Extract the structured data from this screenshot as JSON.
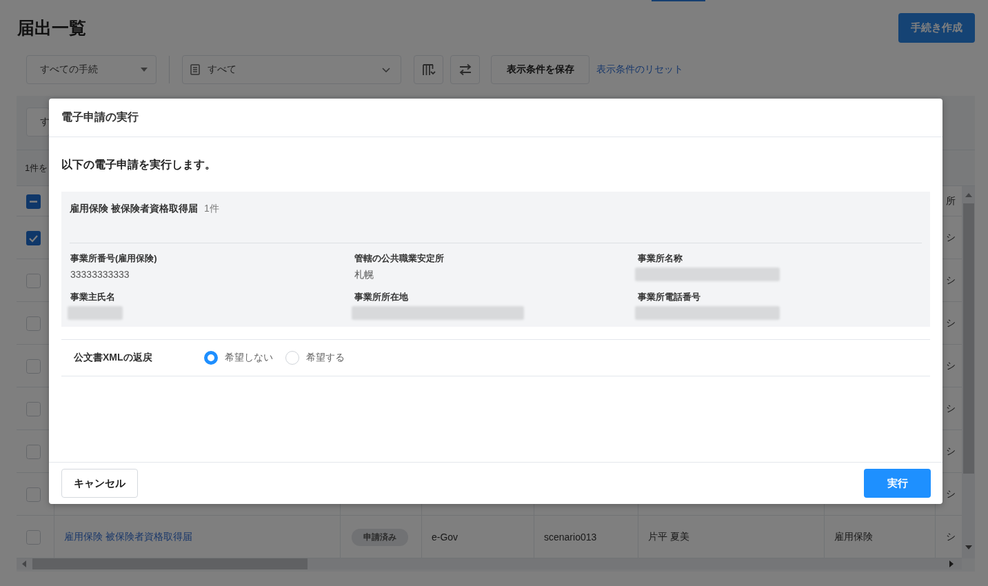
{
  "page": {
    "title": "届出一覧",
    "create_button": "手続き作成"
  },
  "toolbar": {
    "procedure_filter": "すべての手続",
    "document_filter": "すべて",
    "save_button": "表示条件を保存",
    "reset_link": "表示条件のリセット"
  },
  "list": {
    "filter_button": "す",
    "selection_summary": "1件を",
    "table": {
      "header": {
        "select_all_mixed": true,
        "column_8": "所"
      },
      "rows": [
        {
          "checked": true,
          "column_8": "シ"
        },
        {
          "checked": false,
          "column_8": "シ"
        },
        {
          "checked": false,
          "column_8": "シ"
        },
        {
          "checked": false,
          "column_8": "シ"
        },
        {
          "checked": false,
          "column_8": "シ"
        },
        {
          "checked": false,
          "column_8": "シ"
        },
        {
          "checked": false,
          "column_8": "シ"
        },
        {
          "checked": false,
          "procedure": "雇用保険 被保険者資格取得届",
          "status": "申請済み",
          "column_4": "e-Gov",
          "column_5": "scenario013",
          "column_6": "片平 夏美",
          "column_7": "雇用保険",
          "column_8": "シ"
        }
      ]
    }
  },
  "dialog": {
    "title": "電子申請の実行",
    "message": "以下の電子申請を実行します。",
    "summary": {
      "title": "雇用保険 被保険者資格取得届",
      "count": "1件",
      "fields": [
        {
          "label": "事業所番号(雇用保険)",
          "kind": "text",
          "value": "33333333333"
        },
        {
          "label": "管轄の公共職業安定所",
          "kind": "text",
          "value": "札幌"
        },
        {
          "label": "事業所名称",
          "kind": "blurred"
        },
        {
          "label": "事業主氏名",
          "kind": "blurred"
        },
        {
          "label": "事業所所在地",
          "kind": "blurred"
        },
        {
          "label": "事業所電話番号",
          "kind": "blurred"
        }
      ]
    },
    "xml_return": {
      "label": "公文書XMLの返戻",
      "options": [
        {
          "label": "希望しない",
          "selected": true
        },
        {
          "label": "希望する",
          "selected": false
        }
      ]
    },
    "buttons": [
      {
        "kind": "secondary",
        "label": "キャンセル"
      },
      {
        "kind": "primary",
        "label": "実行"
      }
    ]
  }
}
